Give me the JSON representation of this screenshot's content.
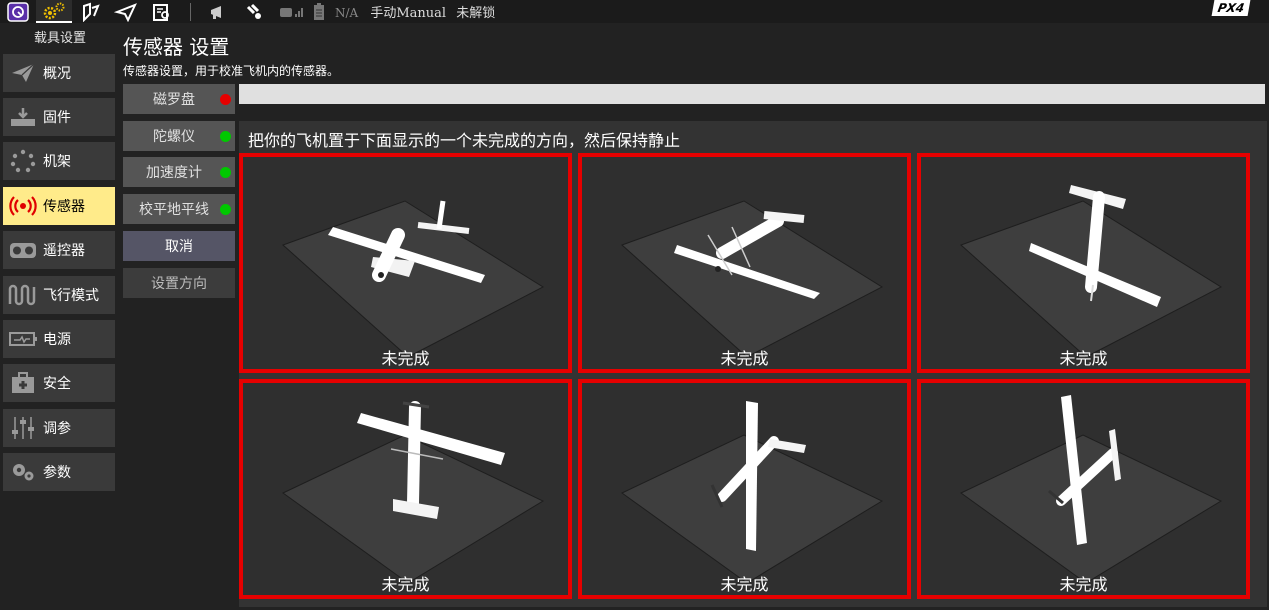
{
  "toolbar": {
    "gps_status": "N/A",
    "flight_mode": "手动Manual",
    "arm_status": "未解锁",
    "brand": "PX4"
  },
  "sidebar": {
    "title": "载具设置",
    "items": [
      {
        "label": "概况",
        "icon": "paper-plane-icon"
      },
      {
        "label": "固件",
        "icon": "firmware-download-icon"
      },
      {
        "label": "机架",
        "icon": "airframe-icon"
      },
      {
        "label": "传感器",
        "icon": "sensors-icon",
        "active": true
      },
      {
        "label": "遥控器",
        "icon": "radio-icon"
      },
      {
        "label": "飞行模式",
        "icon": "flight-modes-icon"
      },
      {
        "label": "电源",
        "icon": "battery-icon"
      },
      {
        "label": "安全",
        "icon": "safety-icon"
      },
      {
        "label": "调参",
        "icon": "tuning-sliders-icon"
      },
      {
        "label": "参数",
        "icon": "parameters-gears-icon"
      }
    ]
  },
  "page": {
    "title": "传感器 设置",
    "description": "传感器设置，用于校准飞机内的传感器。"
  },
  "sensors": [
    {
      "label": "磁罗盘",
      "status_color": "#e60000"
    },
    {
      "label": "陀螺仪",
      "status_color": "#00c800"
    },
    {
      "label": "加速度计",
      "status_color": "#00c800"
    },
    {
      "label": "校平地平线",
      "status_color": "#00c800"
    }
  ],
  "actions": {
    "cancel": "取消",
    "set_orientation": "设置方向"
  },
  "calibration": {
    "progress": 0,
    "instruction": "把你的飞机置于下面显示的一个未完成的方向，然后保持静止",
    "orientations": [
      {
        "name": "nose-down",
        "status": "未完成"
      },
      {
        "name": "left-side",
        "status": "未完成"
      },
      {
        "name": "tail-down",
        "status": "未完成"
      },
      {
        "name": "upright",
        "status": "未完成"
      },
      {
        "name": "right-side",
        "status": "未完成"
      },
      {
        "name": "upside-down",
        "status": "未完成"
      }
    ],
    "border_color": "#e60000"
  }
}
